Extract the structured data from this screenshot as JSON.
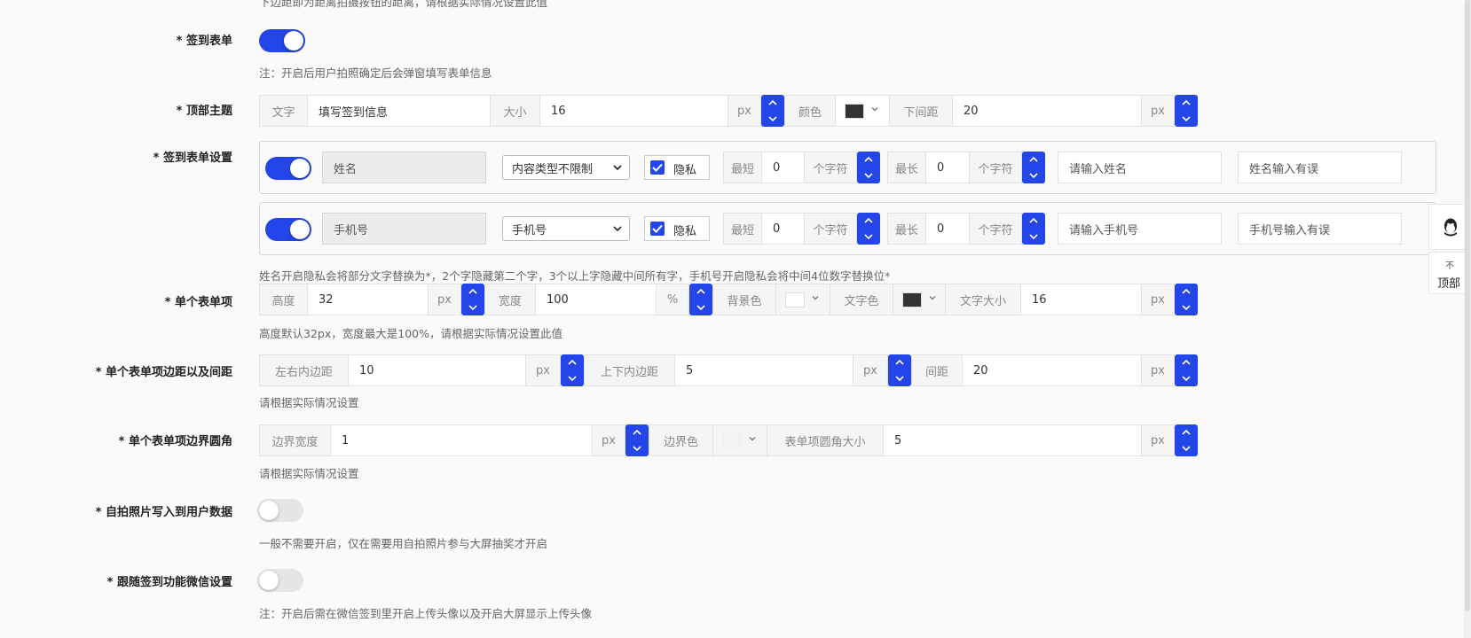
{
  "top_note_cut": "下边距即为距离拍摄按钮的距离，请根据实际情况设置此值",
  "sign_form": {
    "label": "* 签到表单",
    "toggle": "on",
    "note": "注：开启后用户拍照确定后会弹窗填写表单信息"
  },
  "top_theme": {
    "label": "* 顶部主题",
    "text_addon": "文字",
    "text_value": "填写签到信息",
    "size_addon": "大小",
    "size_value": "16",
    "size_unit": "px",
    "color_addon": "颜色",
    "color_value": "#333333",
    "margin_addon": "下间距",
    "margin_value": "20",
    "margin_unit": "px"
  },
  "form_settings": {
    "label": "* 签到表单设置",
    "rows": [
      {
        "enabled": "on",
        "name": "姓名",
        "type": "内容类型不限制",
        "privacy_label": "隐私",
        "privacy_checked": "true",
        "min_addon": "最短",
        "min_value": "0",
        "min_unit": "个字符",
        "max_addon": "最长",
        "max_value": "0",
        "max_unit": "个字符",
        "placeholder": "请输入姓名",
        "error": "姓名输入有误"
      },
      {
        "enabled": "on",
        "name": "手机号",
        "type": "手机号",
        "privacy_label": "隐私",
        "privacy_checked": "true",
        "min_addon": "最短",
        "min_value": "0",
        "min_unit": "个字符",
        "max_addon": "最长",
        "max_value": "0",
        "max_unit": "个字符",
        "placeholder": "请输入手机号",
        "error": "手机号输入有误"
      }
    ],
    "note": "姓名开启隐私会将部分文字替换为*，2个字隐藏第二个字，3个以上字隐藏中间所有字，手机号开启隐私会将中间4位数字替换位*"
  },
  "single_item": {
    "label": "* 单个表单项",
    "height_addon": "高度",
    "height_value": "32",
    "height_unit": "px",
    "width_addon": "宽度",
    "width_value": "100",
    "width_unit": "%",
    "bg_addon": "背景色",
    "bg_value": "#ffffff",
    "fg_addon": "文字色",
    "fg_value": "#333333",
    "fs_addon": "文字大小",
    "fs_value": "16",
    "fs_unit": "px",
    "note": "高度默认32px，宽度最大是100%，请根据实际情况设置此值"
  },
  "padding": {
    "label": "* 单个表单项边距以及间距",
    "lr_addon": "左右内边距",
    "lr_value": "10",
    "lr_unit": "px",
    "tb_addon": "上下内边距",
    "tb_value": "5",
    "tb_unit": "px",
    "gap_addon": "间距",
    "gap_value": "20",
    "gap_unit": "px",
    "note": "请根据实际情况设置"
  },
  "border": {
    "label": "* 单个表单项边界圆角",
    "bw_addon": "边界宽度",
    "bw_value": "1",
    "bw_unit": "px",
    "bc_addon": "边界色",
    "bc_value": "#f2f2f2",
    "radius_addon": "表单项圆角大小",
    "radius_value": "5",
    "radius_unit": "px",
    "note": "请根据实际情况设置"
  },
  "selfie": {
    "label": "* 自拍照片写入到用户数据",
    "toggle": "off",
    "note": "一般不需要开启，仅在需要用自拍照片参与大屏抽奖才开启"
  },
  "wechat": {
    "label": "* 跟随签到功能微信设置",
    "toggle": "off",
    "note": "注：开启后需在微信签到里开启上传头像以及开启大屏显示上传头像"
  },
  "side": {
    "top_label": "顶部",
    "top_arrow": "不"
  }
}
